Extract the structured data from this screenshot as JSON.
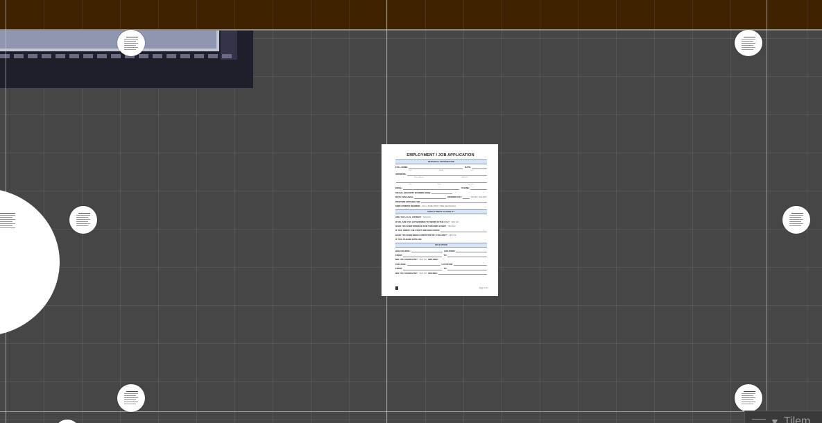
{
  "document": {
    "title": "EMPLOYMENT / JOB APPLICATION",
    "personal_section": "PERSONAL INFORMATION",
    "full_name_label": "FULL NAME:",
    "date_label": "DATE:",
    "full_name_sub": [
      "First",
      "Middle",
      "Last"
    ],
    "address_label": "ADDRESS:",
    "address_sub": [
      "Street Address",
      "Apt/Unit #"
    ],
    "city_sub": [
      "City",
      "State",
      "Zip Code"
    ],
    "email_label": "EMAIL:",
    "phone_label": "PHONE:",
    "ssn_label": "SOCIAL SECURITY NUMBER (SSN):",
    "date_available_label": "DATE AVAILABLE:",
    "desired_pay_label": "DESIRED PAY:",
    "desired_pay_options": "HOUR / SALARY",
    "position_label": "POSITION APPLIED FOR:",
    "employment_desired_label": "EMPLOYMENT DESIRED:",
    "employment_desired_options": "FULL-TIME  PART-TIME  SEASONAL",
    "eligibility_section": "EMPLOYMENT ELIGIBILITY",
    "q_citizen": "ARE YOU A U.S. CITIZEN?",
    "q_citizen_opts": "YES  NO",
    "q_authorized": "IF NO, ARE YOU AUTHORIZED TO WORK IN THE U.S.?",
    "q_authorized_opts": "YES  NO",
    "q_worked_before": "HAVE YOU EVER WORKED FOR THIS EMPLOYER?",
    "q_worked_before_opts": "YES  NO",
    "q_when": "IF YES, WRITE THE START AND END DATES:",
    "q_felony": "HAVE YOU EVER BEEN CONVICTED OF A FELONY?",
    "q_felony_opts": "YES  NO",
    "q_explain": "IF YES, PLEASE EXPLAIN:",
    "education_section": "EDUCATION",
    "high_school_label": "HIGH SCHOOL:",
    "location_label": "LOCATION:",
    "from_label": "FROM:",
    "to_label": "TO:",
    "graduate_label": "DID YOU GRADUATE?",
    "graduate_opts": "YES  NO",
    "diploma_label": "DIPLOMA:",
    "college_label": "COLLEGE:",
    "degree_label": "DEGREE:",
    "footer_page": "Page 1 of 4"
  },
  "corner_panel": {
    "caret_glyph": "▼",
    "label": "Tilem"
  }
}
